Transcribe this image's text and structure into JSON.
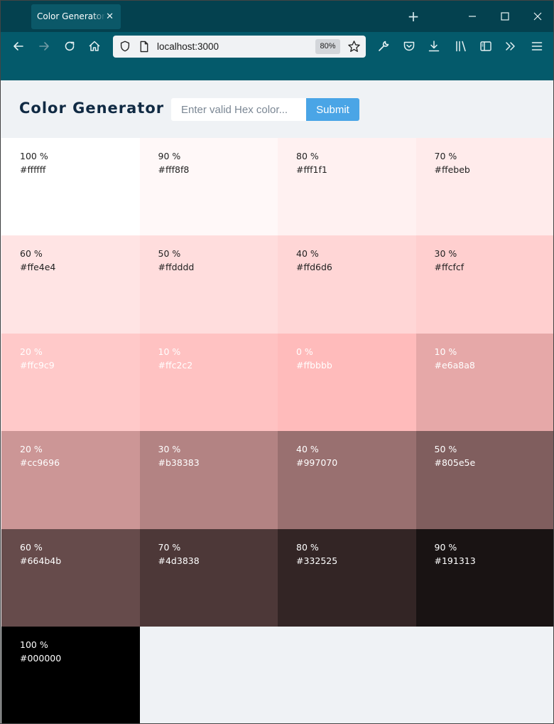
{
  "browser": {
    "tab_title": "Color Generator S",
    "tab_close": "✕",
    "new_tab": "+",
    "url": "localhost:3000",
    "zoom": "80%"
  },
  "app": {
    "title": "Color Generator",
    "input_placeholder": "Enter valid Hex color...",
    "submit_label": "Submit"
  },
  "swatches": [
    {
      "pct": "100 %",
      "hex": "#ffffff",
      "bg": "#ffffff",
      "fg": "#222222"
    },
    {
      "pct": "90 %",
      "hex": "#fff8f8",
      "bg": "#fff8f8",
      "fg": "#222222"
    },
    {
      "pct": "80 %",
      "hex": "#fff1f1",
      "bg": "#fff1f1",
      "fg": "#222222"
    },
    {
      "pct": "70 %",
      "hex": "#ffebeb",
      "bg": "#ffebeb",
      "fg": "#222222"
    },
    {
      "pct": "60 %",
      "hex": "#ffe4e4",
      "bg": "#ffe4e4",
      "fg": "#222222"
    },
    {
      "pct": "50 %",
      "hex": "#ffdddd",
      "bg": "#ffdddd",
      "fg": "#222222"
    },
    {
      "pct": "40 %",
      "hex": "#ffd6d6",
      "bg": "#ffd6d6",
      "fg": "#222222"
    },
    {
      "pct": "30 %",
      "hex": "#ffcfcf",
      "bg": "#ffcfcf",
      "fg": "#222222"
    },
    {
      "pct": "20 %",
      "hex": "#ffc9c9",
      "bg": "#ffc9c9",
      "fg": "#ffffff"
    },
    {
      "pct": "10 %",
      "hex": "#ffc2c2",
      "bg": "#ffc2c2",
      "fg": "#ffffff"
    },
    {
      "pct": "0 %",
      "hex": "#ffbbbb",
      "bg": "#ffbbbb",
      "fg": "#ffffff"
    },
    {
      "pct": "10 %",
      "hex": "#e6a8a8",
      "bg": "#e6a8a8",
      "fg": "#ffffff"
    },
    {
      "pct": "20 %",
      "hex": "#cc9696",
      "bg": "#cc9696",
      "fg": "#ffffff"
    },
    {
      "pct": "30 %",
      "hex": "#b38383",
      "bg": "#b38383",
      "fg": "#ffffff"
    },
    {
      "pct": "40 %",
      "hex": "#997070",
      "bg": "#997070",
      "fg": "#ffffff"
    },
    {
      "pct": "50 %",
      "hex": "#805e5e",
      "bg": "#805e5e",
      "fg": "#ffffff"
    },
    {
      "pct": "60 %",
      "hex": "#664b4b",
      "bg": "#664b4b",
      "fg": "#ffffff"
    },
    {
      "pct": "70 %",
      "hex": "#4d3838",
      "bg": "#4d3838",
      "fg": "#ffffff"
    },
    {
      "pct": "80 %",
      "hex": "#332525",
      "bg": "#332525",
      "fg": "#ffffff"
    },
    {
      "pct": "90 %",
      "hex": "#191313",
      "bg": "#191313",
      "fg": "#ffffff"
    },
    {
      "pct": "100 %",
      "hex": "#000000",
      "bg": "#000000",
      "fg": "#ffffff"
    }
  ],
  "icons": {
    "back": "arrow-left-icon",
    "forward": "arrow-right-icon",
    "reload": "reload-icon",
    "home": "home-icon",
    "shield": "shield-icon",
    "page": "page-icon",
    "star": "star-icon",
    "wrench": "wrench-icon",
    "pocket": "pocket-icon",
    "download": "download-icon",
    "library": "library-icon",
    "sidebar": "sidebar-icon",
    "overflow": "chevrons-right-icon",
    "menu": "hamburger-menu-icon"
  }
}
